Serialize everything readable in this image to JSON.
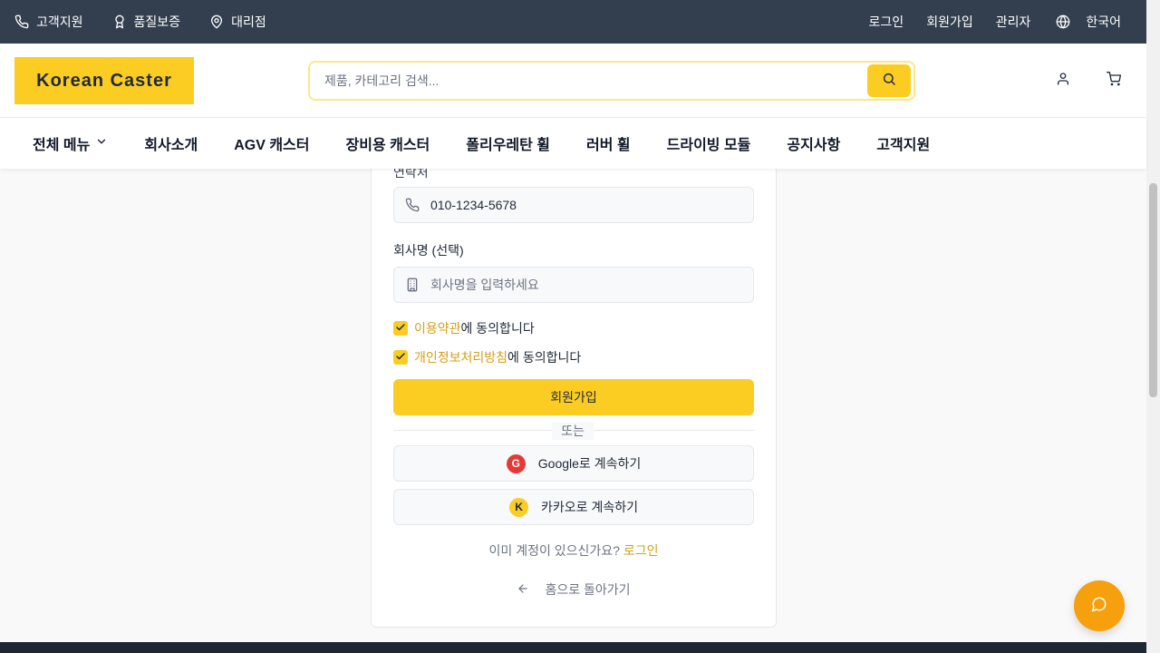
{
  "topbar": {
    "left_items": [
      "고객지원",
      "품질보증",
      "대리점"
    ],
    "login": "로그인",
    "signup": "회원가입",
    "admin": "관리자",
    "language": "한국어"
  },
  "header": {
    "logo": "Korean Caster",
    "search_placeholder": "제품, 카테고리 검색..."
  },
  "nav": {
    "items": [
      "전체 메뉴",
      "회사소개",
      "AGV 캐스터",
      "장비용 캐스터",
      "폴리우레탄 휠",
      "러버 휠",
      "드라이빙 모듈",
      "공지사항",
      "고객지원"
    ]
  },
  "form": {
    "contact_label": "연락처",
    "contact_value": "010-1234-5678",
    "company_label": "회사명 (선택)",
    "company_placeholder": "회사명을 입력하세요",
    "terms_link": "이용약관",
    "terms_suffix": "에 동의합니다",
    "privacy_link": "개인정보처리방침",
    "privacy_suffix": "에 동의합니다",
    "submit": "회원가입",
    "divider": "또는",
    "google_badge": "G",
    "google_label": "Google로 계속하기",
    "kakao_badge": "K",
    "kakao_label": "카카오로 계속하기",
    "have_account": "이미 계정이 있으신가요?",
    "login_link": "로그인",
    "back_home": "홈으로 돌아가기"
  },
  "colors": {
    "accent": "#fbcd23",
    "topbar": "#333f4f",
    "link": "#d4a017",
    "google": "#e53935",
    "chat": "#f5a00c"
  },
  "icons": [
    "phone-icon",
    "award-icon",
    "map-pin-icon",
    "globe-icon",
    "search-icon",
    "user-icon",
    "cart-icon",
    "chevron-down-icon",
    "building-icon",
    "check-icon",
    "arrow-left-icon",
    "chat-icon"
  ]
}
